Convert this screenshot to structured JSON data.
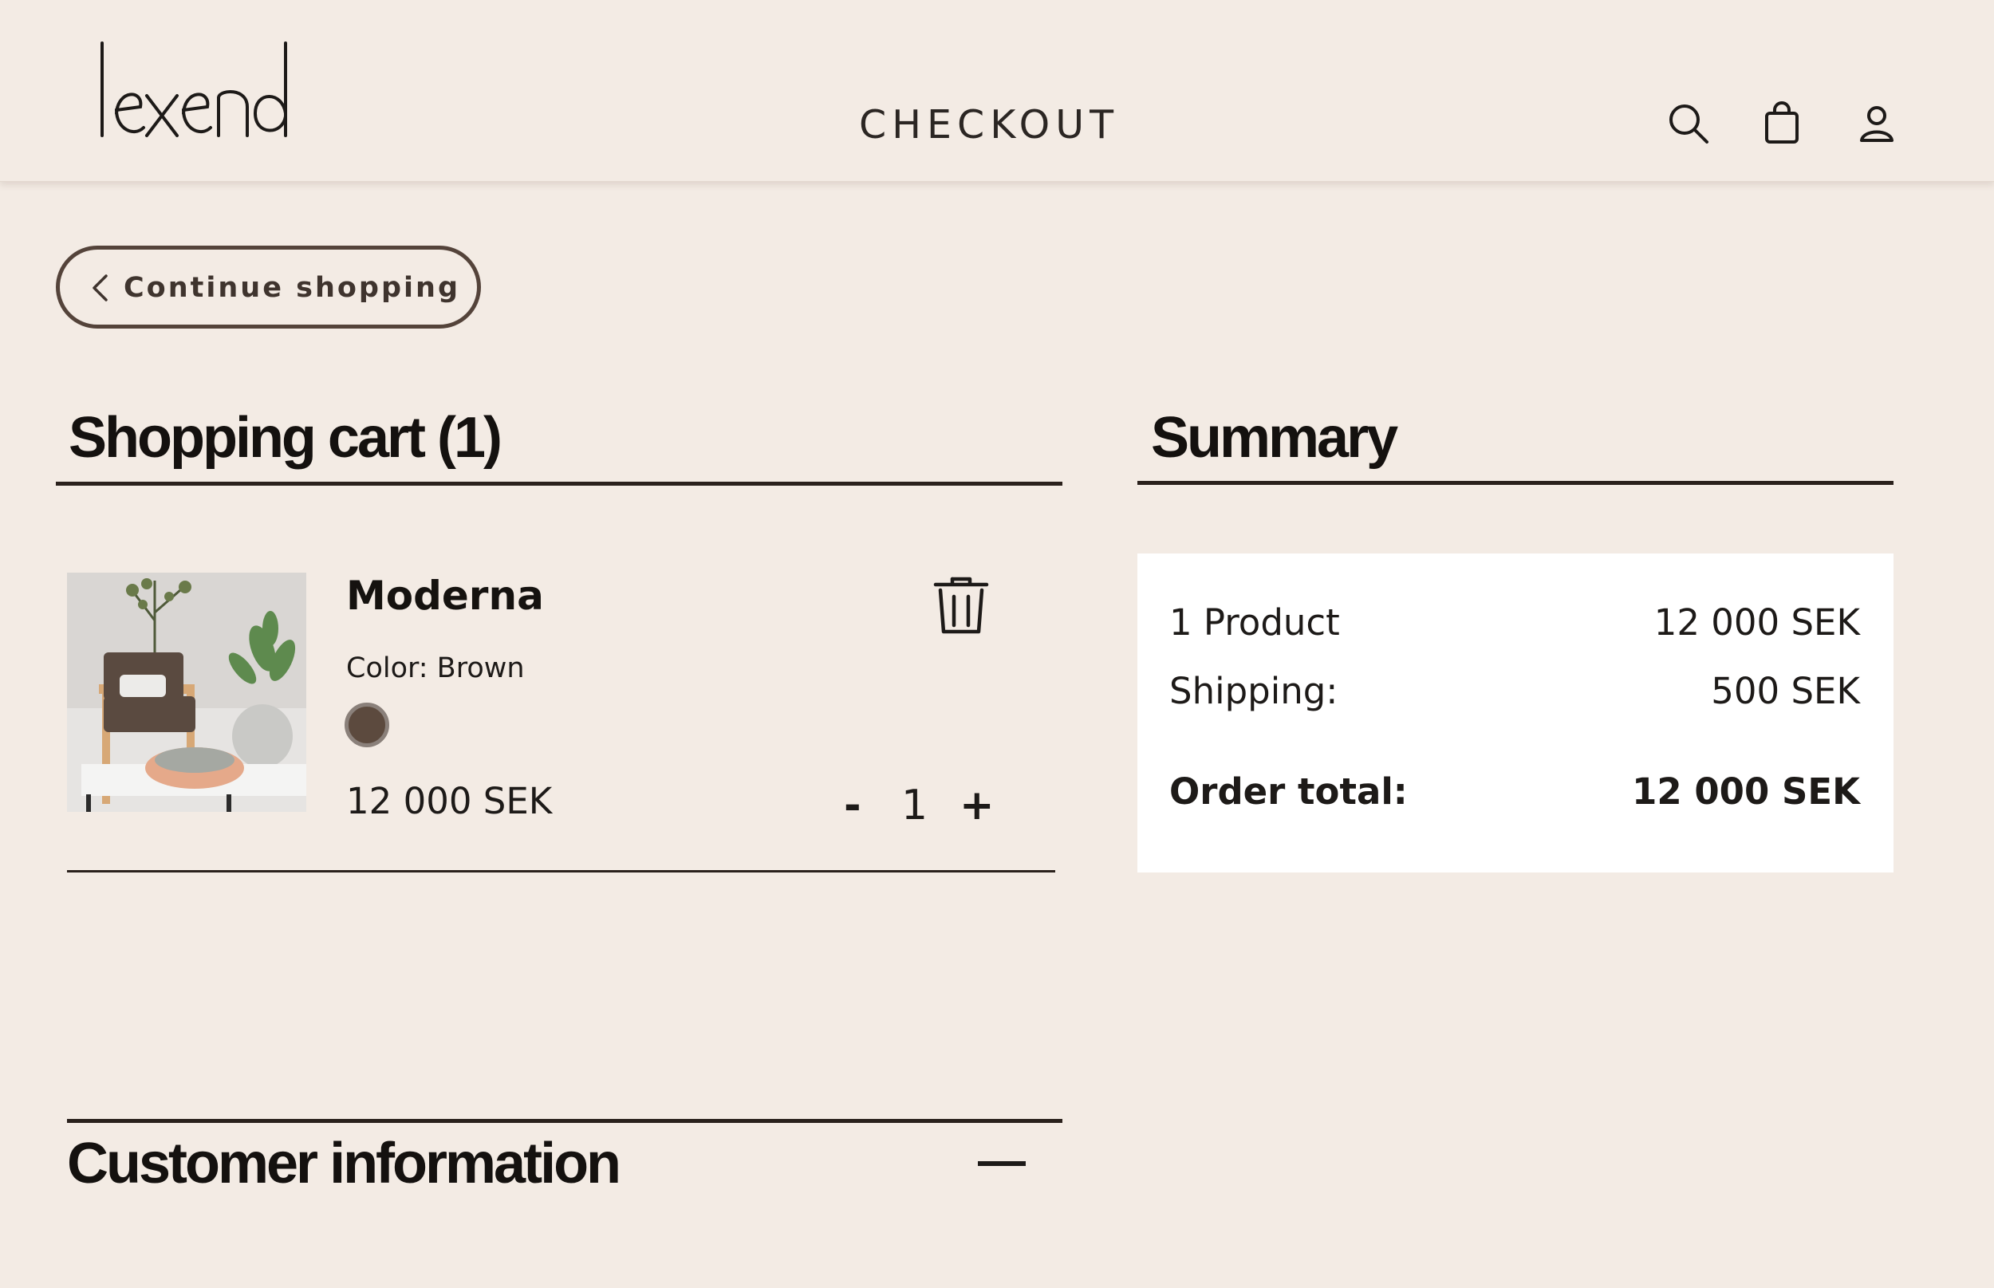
{
  "header": {
    "logo_text": "lexend",
    "title": "CHECKOUT",
    "icons": [
      "search-icon",
      "shopping-bag-icon",
      "user-icon"
    ]
  },
  "nav": {
    "continue_label": "Continue shopping"
  },
  "cart": {
    "title": "Shopping cart (1)",
    "items": [
      {
        "name": "Moderna",
        "color_label": "Color: Brown",
        "color_hex": "#5c4a3e",
        "price": "12 000 SEK",
        "quantity": "1",
        "minus": "-",
        "plus": "+"
      }
    ]
  },
  "summary": {
    "title": "Summary",
    "rows": [
      {
        "label": "1 Product",
        "value": "12 000 SEK"
      },
      {
        "label": "Shipping:",
        "value": "500 SEK"
      }
    ],
    "total_label": "Order total:",
    "total_value": "12 000 SEK"
  },
  "customer": {
    "title": "Customer information"
  },
  "colors": {
    "background": "#f3ebe4",
    "text": "#1d1a18",
    "button_border": "#54433a",
    "summary_bg": "#ffffff"
  }
}
